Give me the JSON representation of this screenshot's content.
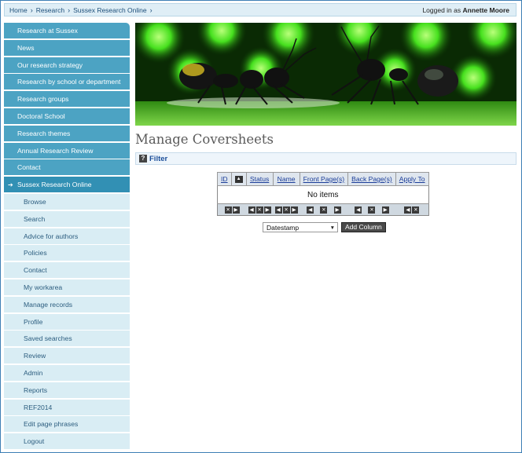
{
  "breadcrumb": {
    "items": [
      "Home",
      "Research",
      "Sussex Research Online"
    ]
  },
  "login": {
    "prefix": "Logged in as",
    "user": "Annette Moore"
  },
  "sidebar": {
    "main_items": [
      "Research at Sussex",
      "News",
      "Our research strategy",
      "Research by school or department",
      "Research groups",
      "Doctoral School",
      "Research themes",
      "Annual Research Review",
      "Contact"
    ],
    "active_item": "Sussex Research Online",
    "sub_items": [
      "Browse",
      "Search",
      "Advice for authors",
      "Policies",
      "Contact",
      "My workarea",
      "Manage records",
      "Profile",
      "Saved searches",
      "Review",
      "Admin",
      "Reports",
      "REF2014",
      "Edit page phrases",
      "Logout"
    ]
  },
  "page": {
    "title": "Manage Coversheets"
  },
  "filter": {
    "label": "Filter",
    "icon": "help-icon"
  },
  "table": {
    "headers": [
      "ID",
      "Status",
      "Name",
      "Front Page(s)",
      "Back Page(s)",
      "Apply To"
    ],
    "empty_text": "No items"
  },
  "column_control": {
    "selected": "Datestamp",
    "button": "Add Column"
  },
  "colors": {
    "nav": "#4ca3c3",
    "nav_active": "#3290b4",
    "subnav": "#d9edf4",
    "link": "#1b3d99"
  }
}
